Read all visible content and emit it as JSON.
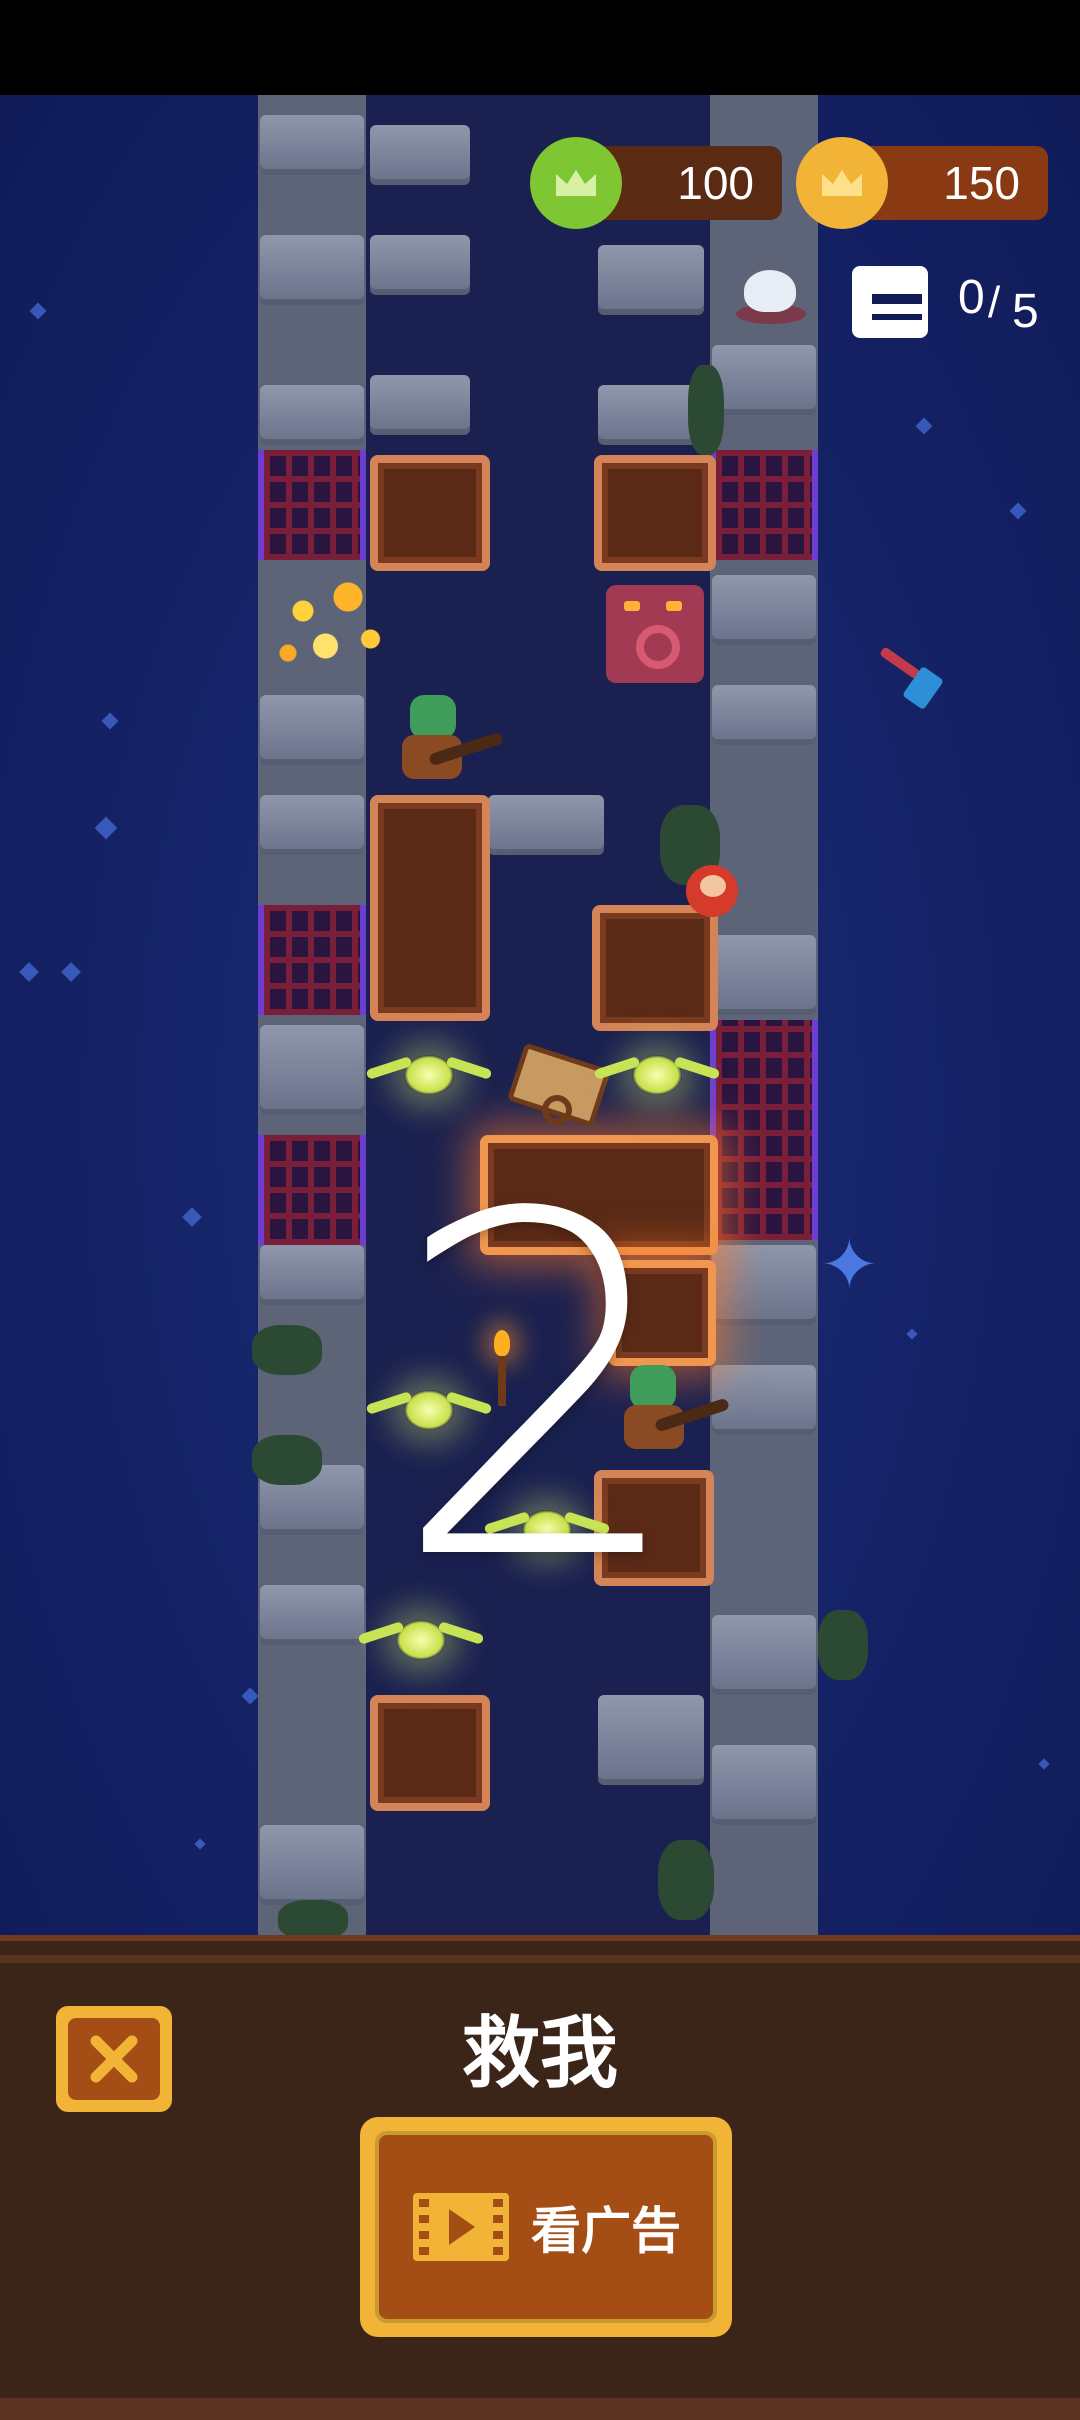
{
  "hud": {
    "green_crowns": "100",
    "gold_crowns": "150",
    "prisoners_rescued": "0",
    "prisoners_total": "5",
    "green_color": "#7ec733",
    "gold_color": "#f2b437",
    "pill_color": "#5a2a12"
  },
  "countdown": {
    "value": "2"
  },
  "rescue_panel": {
    "title": "救我",
    "watch_ad_label": "看广告",
    "close_icon": "close-x-icon",
    "ad_icon": "video-play-icon"
  }
}
